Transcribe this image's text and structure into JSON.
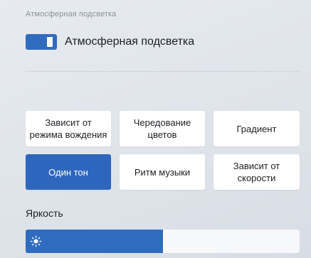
{
  "section": {
    "title": "Атмосферная подсветка"
  },
  "toggle": {
    "label": "Атмосферная подсветка",
    "state": "on",
    "accent_color": "#2f6cc0"
  },
  "modes": {
    "items": [
      {
        "label": "Зависит от\nрежима вождения",
        "active": false
      },
      {
        "label": "Чередование\nцветов",
        "active": false
      },
      {
        "label": "Градиент",
        "active": false
      },
      {
        "label": "Один тон",
        "active": true
      },
      {
        "label": "Ритм музыки",
        "active": false
      },
      {
        "label": "Зависит от\nскорости",
        "active": false
      }
    ],
    "active_color": "#2e66be"
  },
  "brightness": {
    "label": "Яркость",
    "value_fraction": 0.5,
    "icon": "sun-icon"
  }
}
